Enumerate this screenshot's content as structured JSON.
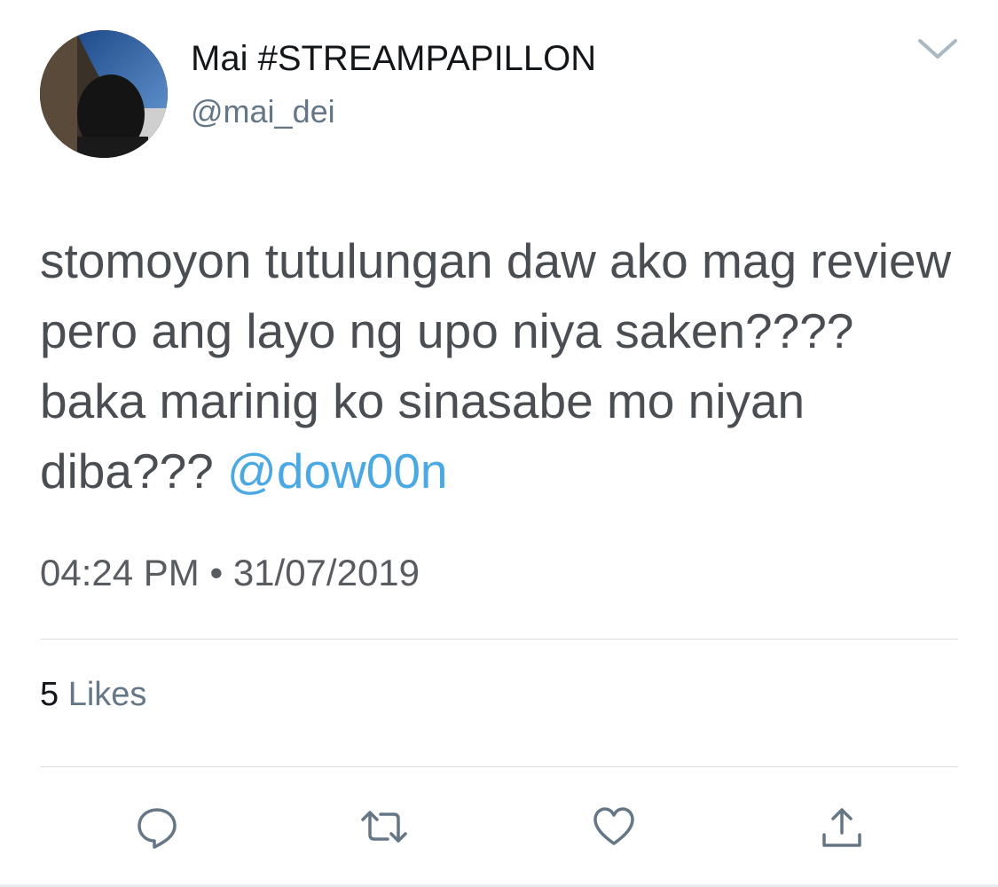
{
  "author": {
    "display_name": "Mai #STREAMPAPILLON",
    "handle": "@mai_dei"
  },
  "tweet": {
    "text": "stomoyon tutulungan daw ako mag review pero ang layo ng upo niya saken???? baka marinig ko sinasabe mo niyan diba??? ",
    "mention": "@dow00n",
    "timestamp": "04:24 PM • 31/07/2019"
  },
  "stats": {
    "likes_count": "5",
    "likes_label": "Likes"
  },
  "actions": [
    "reply-icon",
    "retweet-icon",
    "like-icon",
    "share-icon"
  ],
  "colors": {
    "mention": "#4aa9e3",
    "secondary_text": "#657786",
    "icon": "#657786"
  }
}
